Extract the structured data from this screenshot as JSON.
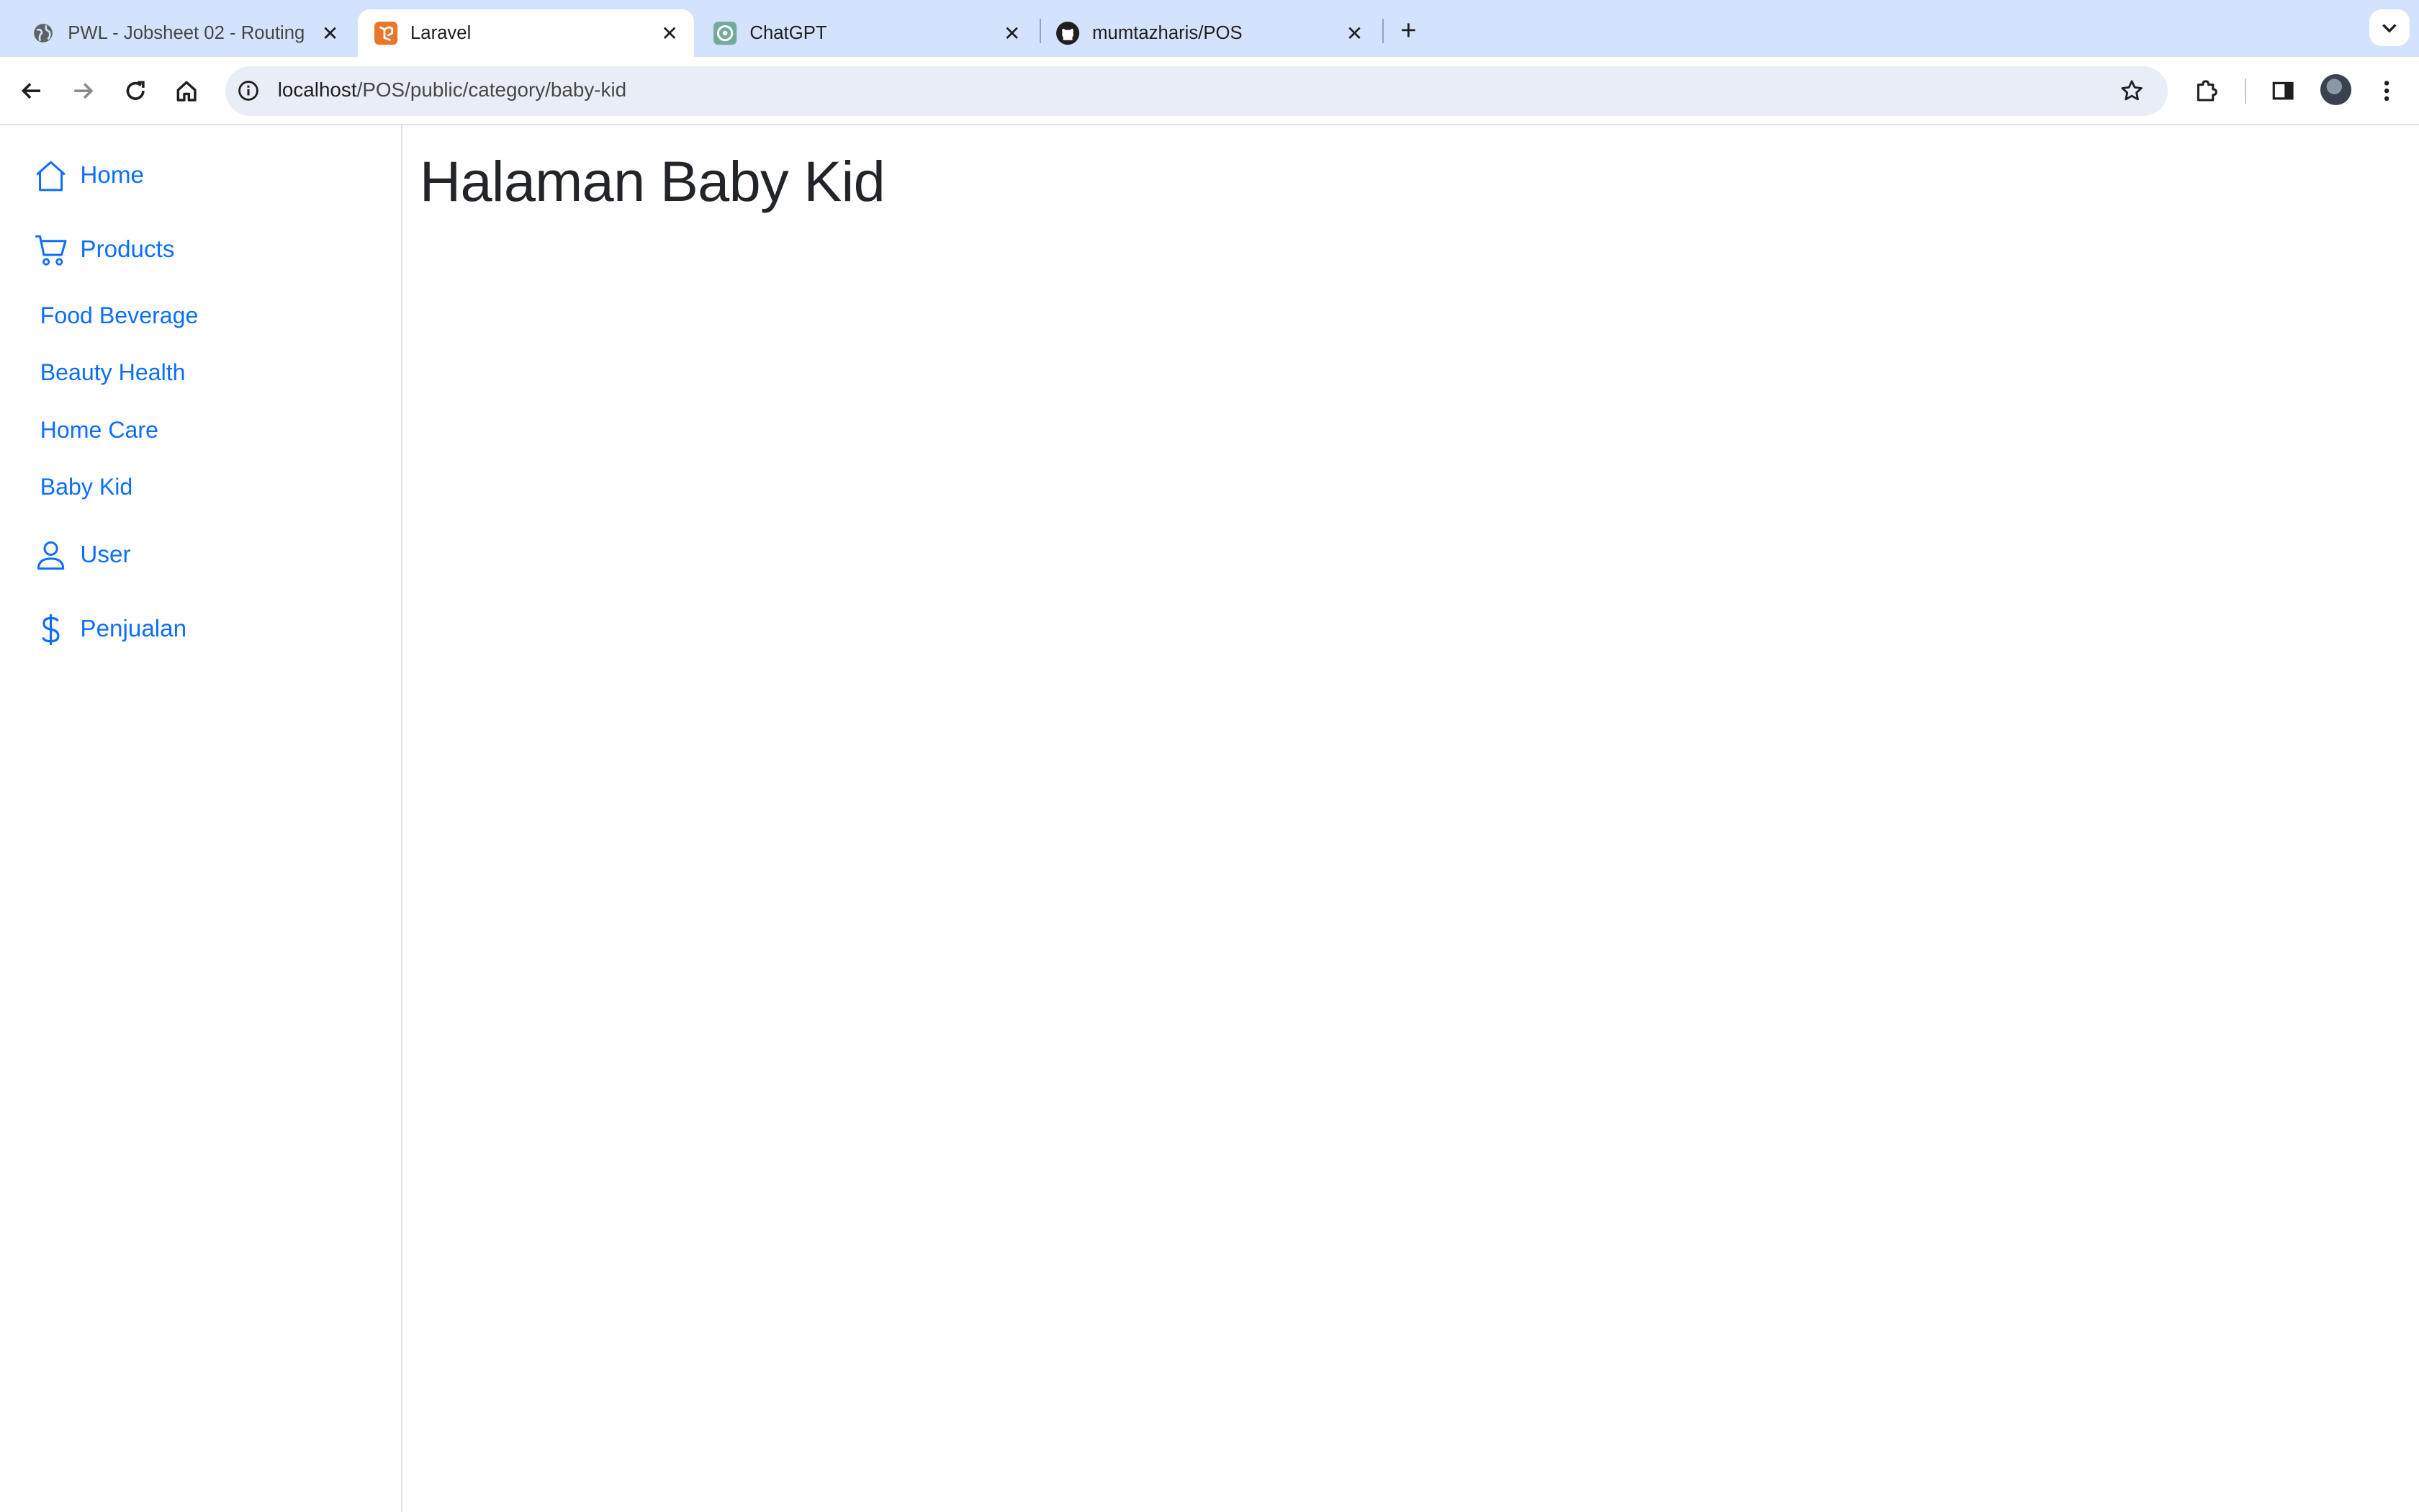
{
  "browser": {
    "tabs": [
      {
        "title": "PWL - Jobsheet 02 - Routing",
        "favicon": "globe-icon",
        "active": false
      },
      {
        "title": "Laravel",
        "favicon": "laravel-icon",
        "active": true
      },
      {
        "title": "ChatGPT",
        "favicon": "chatgpt-icon",
        "active": false
      },
      {
        "title": "mumtazharis/POS",
        "favicon": "github-icon",
        "active": false
      }
    ],
    "url_host": "localhost",
    "url_path": "/POS/public/category/baby-kid"
  },
  "sidebar": {
    "home": "Home",
    "products": "Products",
    "categories": [
      "Food Beverage",
      "Beauty Health",
      "Home Care",
      "Baby Kid"
    ],
    "user": "User",
    "sales": "Penjualan"
  },
  "main": {
    "title": "Halaman Baby Kid"
  },
  "colors": {
    "link": "#0d6efd",
    "tabstrip": "#d3e3fd",
    "heading": "#212529"
  }
}
